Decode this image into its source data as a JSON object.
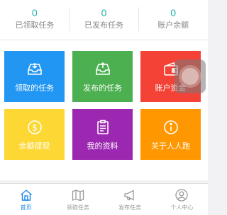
{
  "stats": [
    {
      "value": "0",
      "label": "已领取任务"
    },
    {
      "value": "0",
      "label": "已发布任务"
    },
    {
      "value": "0",
      "label": "账户余额"
    }
  ],
  "tiles": [
    {
      "label": "领取的任务",
      "icon": "inbox-download-icon",
      "color": "#2196f3"
    },
    {
      "label": "发布的任务",
      "icon": "inbox-upload-icon",
      "color": "#4caf50"
    },
    {
      "label": "账户资金",
      "icon": "wallet-icon",
      "color": "#f44336"
    },
    {
      "label": "余额提现",
      "icon": "dollar-coin-icon",
      "color": "#fdd835"
    },
    {
      "label": "我的资料",
      "icon": "clipboard-icon",
      "color": "#9c27b0"
    },
    {
      "label": "关于人人跑",
      "icon": "info-icon",
      "color": "#ff9800"
    }
  ],
  "tabbar": [
    {
      "label": "首页",
      "icon": "home-icon",
      "active": true
    },
    {
      "label": "领取任务",
      "icon": "map-icon",
      "active": false
    },
    {
      "label": "发布任务",
      "icon": "megaphone-icon",
      "active": false
    },
    {
      "label": "个人中心",
      "icon": "user-icon",
      "active": false
    }
  ],
  "colors": {
    "accent": "#1fb3a8",
    "tab_active": "#1e88e5"
  }
}
